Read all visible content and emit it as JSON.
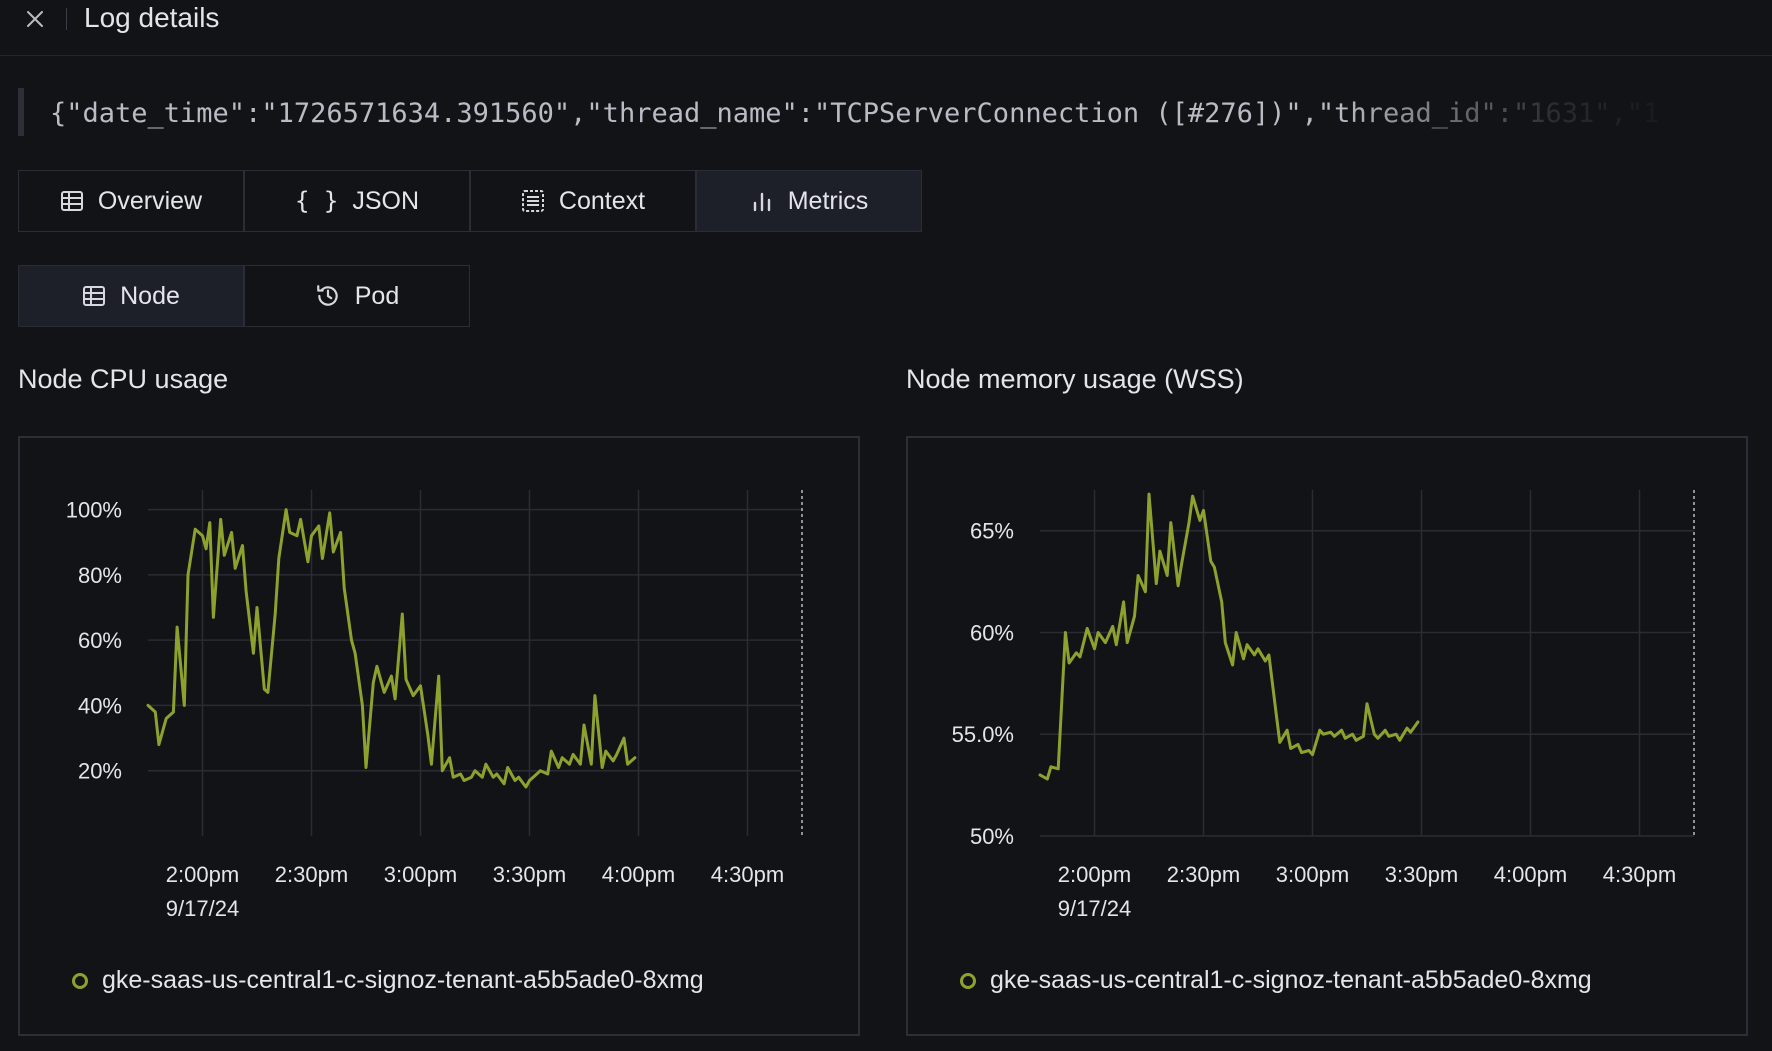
{
  "header": {
    "title": "Log details"
  },
  "log": {
    "line": "{\"date_time\":\"1726571634.391560\",\"thread_name\":\"TCPServerConnection ([#276])\",\"thread_id\":\"1631\",\"1"
  },
  "tabs": [
    {
      "label": "Overview",
      "icon": "table-icon"
    },
    {
      "label": "JSON",
      "icon": "braces-icon"
    },
    {
      "label": "Context",
      "icon": "list-icon"
    },
    {
      "label": "Metrics",
      "icon": "bar-chart-icon",
      "active": true
    }
  ],
  "subtabs": [
    {
      "label": "Node",
      "icon": "table-icon",
      "active": true
    },
    {
      "label": "Pod",
      "icon": "history-icon"
    }
  ],
  "colors": {
    "series": "#8ea12e",
    "background": "#121317",
    "grid": "#2a2c33"
  },
  "chart_data": [
    {
      "type": "line",
      "title": "Node CPU usage",
      "x_ticks": [
        "2:00pm",
        "2:30pm",
        "3:00pm",
        "3:30pm",
        "4:00pm",
        "4:30pm"
      ],
      "x_date_label": "9/17/24",
      "x_range": [
        "1:45pm",
        "4:45pm"
      ],
      "y_ticks": [
        "100%",
        "80%",
        "60%",
        "40%",
        "20%"
      ],
      "y_tick_values": [
        100,
        80,
        60,
        40,
        20
      ],
      "ylim": [
        0,
        106
      ],
      "grid": true,
      "legend_position": "bottom-left",
      "series": [
        {
          "name": "gke-saas-us-central1-c-signoz-tenant-a5b5ade0-8xmg",
          "points": [
            [
              "1:45pm",
              40
            ],
            [
              "1:47pm",
              38
            ],
            [
              "1:48pm",
              28
            ],
            [
              "1:50pm",
              36
            ],
            [
              "1:52pm",
              38
            ],
            [
              "1:53pm",
              64
            ],
            [
              "1:55pm",
              40
            ],
            [
              "1:56pm",
              80
            ],
            [
              "1:58pm",
              94
            ],
            [
              "2:00pm",
              92
            ],
            [
              "2:01pm",
              88
            ],
            [
              "2:02pm",
              96
            ],
            [
              "2:03pm",
              67
            ],
            [
              "2:05pm",
              97
            ],
            [
              "2:06pm",
              86
            ],
            [
              "2:08pm",
              93
            ],
            [
              "2:09pm",
              82
            ],
            [
              "2:11pm",
              89
            ],
            [
              "2:12pm",
              75
            ],
            [
              "2:14pm",
              56
            ],
            [
              "2:15pm",
              70
            ],
            [
              "2:17pm",
              45
            ],
            [
              "2:18pm",
              44
            ],
            [
              "2:20pm",
              68
            ],
            [
              "2:21pm",
              85
            ],
            [
              "2:23pm",
              100
            ],
            [
              "2:24pm",
              93
            ],
            [
              "2:26pm",
              92
            ],
            [
              "2:27pm",
              97
            ],
            [
              "2:29pm",
              84
            ],
            [
              "2:30pm",
              92
            ],
            [
              "2:32pm",
              95
            ],
            [
              "2:33pm",
              85
            ],
            [
              "2:35pm",
              99
            ],
            [
              "2:36pm",
              87
            ],
            [
              "2:38pm",
              93
            ],
            [
              "2:39pm",
              76
            ],
            [
              "2:41pm",
              60
            ],
            [
              "2:42pm",
              56
            ],
            [
              "2:44pm",
              40
            ],
            [
              "2:45pm",
              21
            ],
            [
              "2:47pm",
              47
            ],
            [
              "2:48pm",
              52
            ],
            [
              "2:50pm",
              44
            ],
            [
              "2:52pm",
              49
            ],
            [
              "2:53pm",
              42
            ],
            [
              "2:55pm",
              68
            ],
            [
              "2:56pm",
              48
            ],
            [
              "2:58pm",
              43
            ],
            [
              "3:00pm",
              46
            ],
            [
              "3:02pm",
              31
            ],
            [
              "3:03pm",
              22
            ],
            [
              "3:05pm",
              49
            ],
            [
              "3:06pm",
              20
            ],
            [
              "3:08pm",
              24
            ],
            [
              "3:09pm",
              18
            ],
            [
              "3:11pm",
              19
            ],
            [
              "3:12pm",
              17
            ],
            [
              "3:14pm",
              18
            ],
            [
              "3:15pm",
              20
            ],
            [
              "3:17pm",
              18
            ],
            [
              "3:18pm",
              22
            ],
            [
              "3:20pm",
              18
            ],
            [
              "3:21pm",
              19
            ],
            [
              "3:23pm",
              16
            ],
            [
              "3:24pm",
              21
            ],
            [
              "3:26pm",
              17
            ],
            [
              "3:27pm",
              18
            ],
            [
              "3:29pm",
              15
            ],
            [
              "3:30pm",
              17
            ],
            [
              "3:32pm",
              19
            ],
            [
              "3:33pm",
              20
            ],
            [
              "3:35pm",
              19
            ],
            [
              "3:36pm",
              26
            ],
            [
              "3:38pm",
              21
            ],
            [
              "3:39pm",
              24
            ],
            [
              "3:41pm",
              22
            ],
            [
              "3:42pm",
              25
            ],
            [
              "3:44pm",
              22
            ],
            [
              "3:45pm",
              34
            ],
            [
              "3:47pm",
              22
            ],
            [
              "3:48pm",
              43
            ],
            [
              "3:50pm",
              21
            ],
            [
              "3:51pm",
              26
            ],
            [
              "3:53pm",
              23
            ],
            [
              "3:54pm",
              25
            ],
            [
              "3:56pm",
              30
            ],
            [
              "3:57pm",
              22
            ],
            [
              "3:59pm",
              24
            ]
          ]
        }
      ]
    },
    {
      "type": "line",
      "title": "Node memory usage (WSS)",
      "x_ticks": [
        "2:00pm",
        "2:30pm",
        "3:00pm",
        "3:30pm",
        "4:00pm",
        "4:30pm"
      ],
      "x_date_label": "9/17/24",
      "x_range": [
        "1:45pm",
        "4:45pm"
      ],
      "y_ticks": [
        "65%",
        "60%",
        "55.0%",
        "50%"
      ],
      "y_tick_values": [
        65,
        60,
        55,
        50
      ],
      "ylim": [
        50,
        67
      ],
      "grid": true,
      "legend_position": "bottom-left",
      "series": [
        {
          "name": "gke-saas-us-central1-c-signoz-tenant-a5b5ade0-8xmg",
          "points": [
            [
              "1:45pm",
              53
            ],
            [
              "1:47pm",
              52.8
            ],
            [
              "1:48pm",
              53.4
            ],
            [
              "1:50pm",
              53.3
            ],
            [
              "1:52pm",
              60
            ],
            [
              "1:53pm",
              58.5
            ],
            [
              "1:55pm",
              59
            ],
            [
              "1:56pm",
              58.8
            ],
            [
              "1:58pm",
              60.2
            ],
            [
              "2:00pm",
              59.2
            ],
            [
              "2:01pm",
              60
            ],
            [
              "2:03pm",
              59.5
            ],
            [
              "2:05pm",
              60.3
            ],
            [
              "2:06pm",
              59.4
            ],
            [
              "2:08pm",
              61.5
            ],
            [
              "2:09pm",
              59.5
            ],
            [
              "2:11pm",
              60.8
            ],
            [
              "2:12pm",
              62.8
            ],
            [
              "2:14pm",
              62
            ],
            [
              "2:15pm",
              66.8
            ],
            [
              "2:17pm",
              62.4
            ],
            [
              "2:18pm",
              64
            ],
            [
              "2:20pm",
              62.8
            ],
            [
              "2:21pm",
              65.4
            ],
            [
              "2:23pm",
              62.3
            ],
            [
              "2:24pm",
              63.4
            ],
            [
              "2:26pm",
              65.4
            ],
            [
              "2:27pm",
              66.7
            ],
            [
              "2:29pm",
              65.5
            ],
            [
              "2:30pm",
              66
            ],
            [
              "2:32pm",
              63.5
            ],
            [
              "2:33pm",
              63.2
            ],
            [
              "2:35pm",
              61.5
            ],
            [
              "2:36pm",
              59.5
            ],
            [
              "2:38pm",
              58.4
            ],
            [
              "2:39pm",
              60
            ],
            [
              "2:41pm",
              58.7
            ],
            [
              "2:42pm",
              59.4
            ],
            [
              "2:44pm",
              58.9
            ],
            [
              "2:45pm",
              59.2
            ],
            [
              "2:47pm",
              58.6
            ],
            [
              "2:48pm",
              58.9
            ],
            [
              "2:50pm",
              56
            ],
            [
              "2:51pm",
              54.6
            ],
            [
              "2:53pm",
              55.2
            ],
            [
              "2:54pm",
              54.3
            ],
            [
              "2:56pm",
              54.5
            ],
            [
              "2:57pm",
              54.1
            ],
            [
              "2:59pm",
              54.2
            ],
            [
              "3:00pm",
              54
            ],
            [
              "3:02pm",
              55.2
            ],
            [
              "3:03pm",
              55
            ],
            [
              "3:05pm",
              55.1
            ],
            [
              "3:06pm",
              54.9
            ],
            [
              "3:08pm",
              55.2
            ],
            [
              "3:09pm",
              54.8
            ],
            [
              "3:11pm",
              55
            ],
            [
              "3:12pm",
              54.7
            ],
            [
              "3:14pm",
              54.9
            ],
            [
              "3:15pm",
              56.5
            ],
            [
              "3:17pm",
              55
            ],
            [
              "3:18pm",
              54.8
            ],
            [
              "3:20pm",
              55.2
            ],
            [
              "3:21pm",
              54.9
            ],
            [
              "3:23pm",
              55
            ],
            [
              "3:24pm",
              54.7
            ],
            [
              "3:26pm",
              55.3
            ],
            [
              "3:27pm",
              55.1
            ],
            [
              "3:29pm",
              55.6
            ]
          ]
        }
      ]
    }
  ]
}
